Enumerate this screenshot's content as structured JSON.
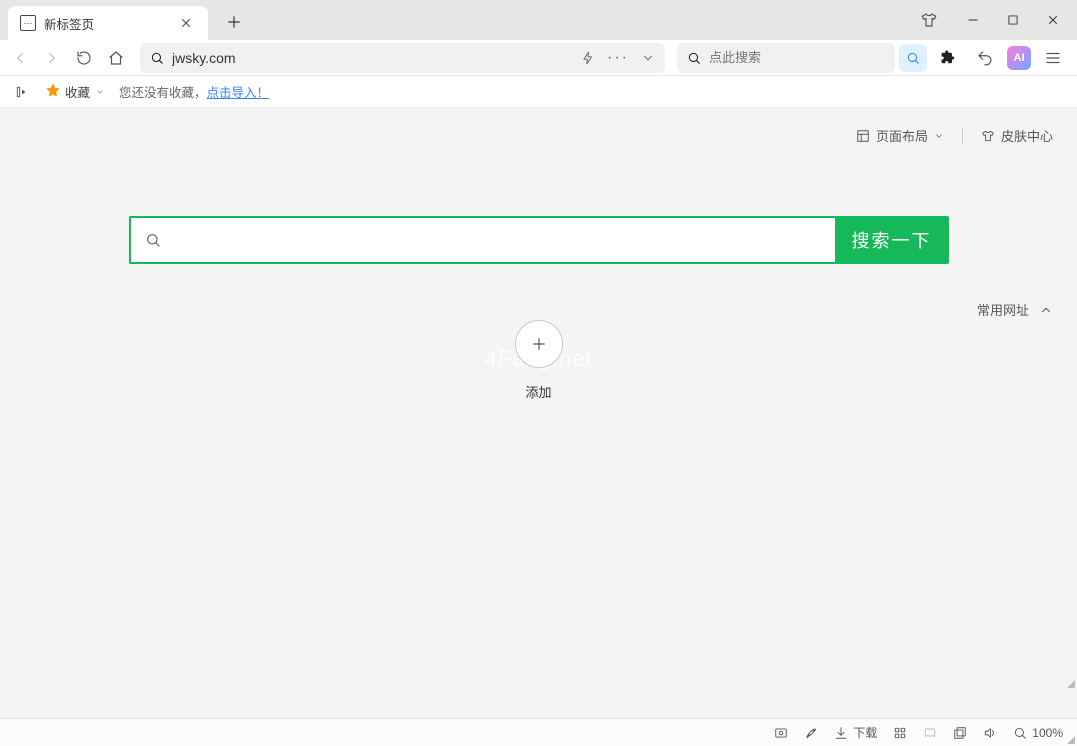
{
  "tab": {
    "title": "新标签页"
  },
  "toolbar": {
    "url": "jwsky.com",
    "search_placeholder": "点此搜索"
  },
  "bookmarks": {
    "label": "收藏",
    "hint_prefix": "您还没有收藏，",
    "hint_link": "点击导入！"
  },
  "page": {
    "layout_label": "页面布局",
    "skin_label": "皮肤中心",
    "search_button": "搜索一下",
    "freq_label": "常用网址",
    "add_label": "添加",
    "watermark": "4Fang.net"
  },
  "statusbar": {
    "download": "下载",
    "zoom": "100%"
  },
  "ai_badge": "AI"
}
